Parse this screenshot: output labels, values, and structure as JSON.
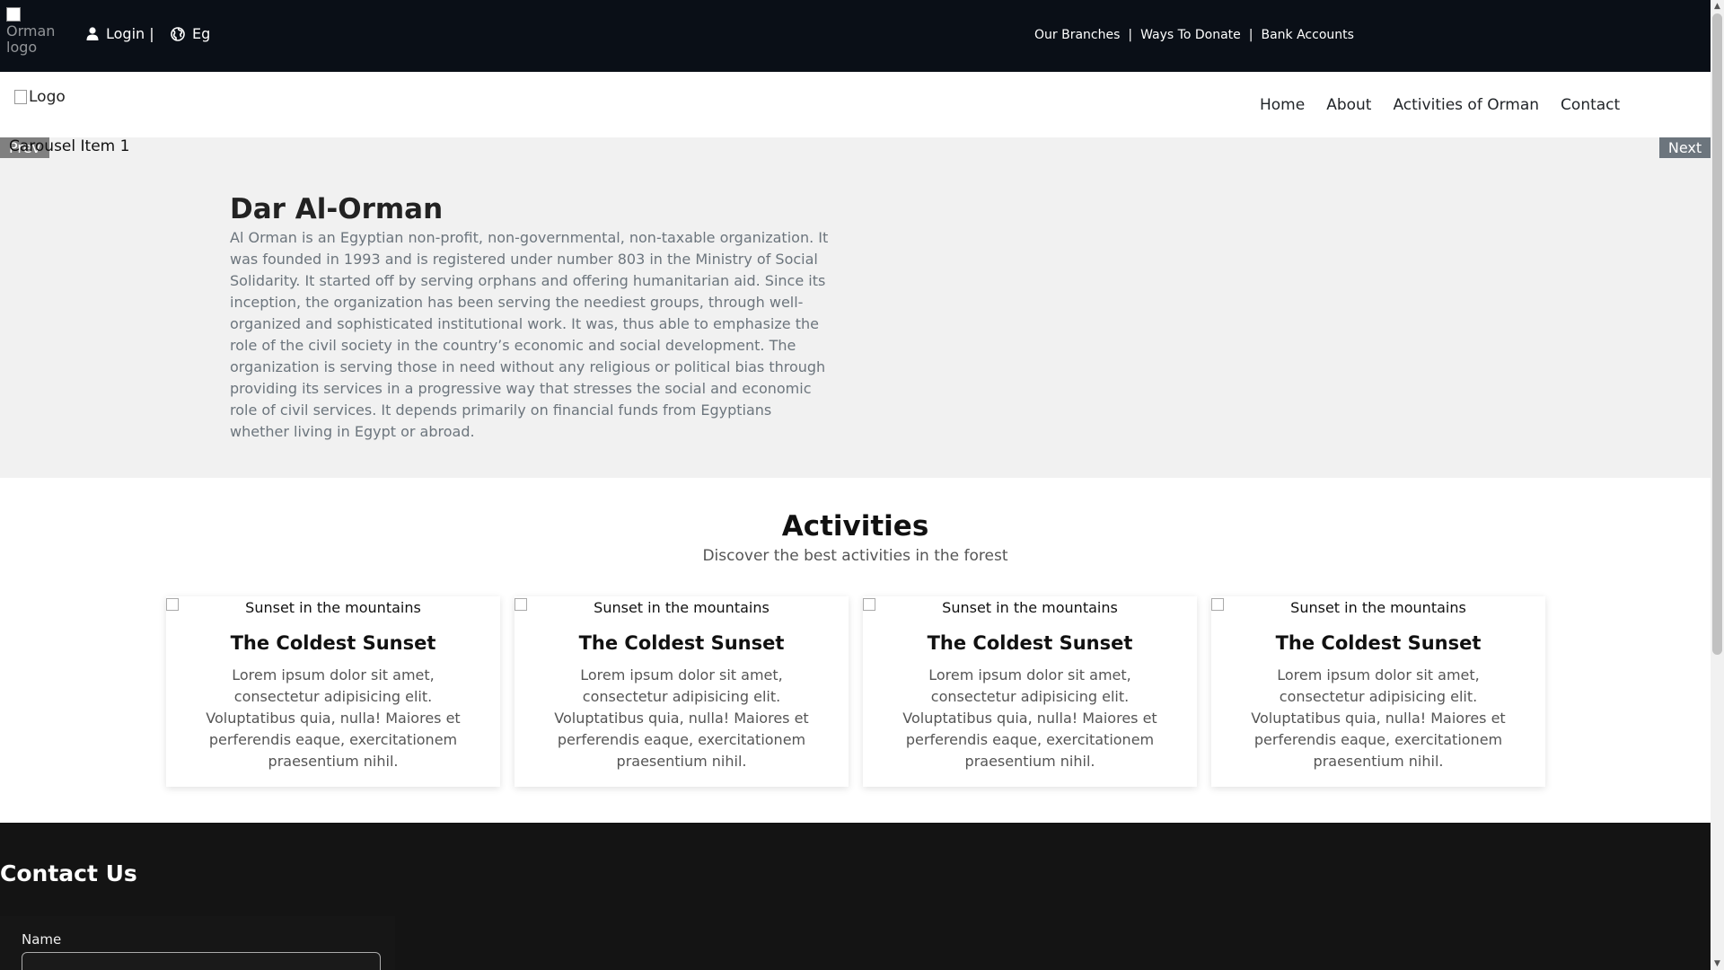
{
  "topbar": {
    "logo_alt": "Orman logo",
    "login_label": "Login |",
    "lang_label": "Eg",
    "links": [
      "Our Branches",
      "Ways To Donate",
      "Bank Accounts"
    ],
    "separator": "|"
  },
  "navbar": {
    "logo_alt": "Logo",
    "links": [
      "Home",
      "About",
      "Activities of Orman",
      "Contact"
    ]
  },
  "carousel": {
    "item_label": "Carousel Item 1",
    "prev_label": "Prev",
    "next_label": "Next",
    "title": "Dar Al-Orman",
    "text": "Al Orman is an Egyptian non-profit, non-governmental, non-taxable organization. It was founded in 1993 and is registered under number 803 in the Ministry of Social Solidarity. It started off by serving orphans and offering humanitarian aid. Since its inception, the organization has been serving the neediest groups, through well-organized and sophisticated institutional work. It was, thus able to emphasize the role of the civil society in the country’s economic and social development. The organization is serving those in need without any religious or political bias through providing its services in a progressive way that stresses the social and economic role of civil services. It depends primarily on financial funds from Egyptians whether living in Egypt or abroad."
  },
  "activities": {
    "title": "Activities",
    "subtitle": "Discover the best activities in the forest",
    "cards": [
      {
        "img_alt": "Sunset in the mountains",
        "title": "The Coldest Sunset",
        "text": "Lorem ipsum dolor sit amet, consectetur adipisicing elit. Voluptatibus quia, nulla! Maiores et perferendis eaque, exercitationem praesentium nihil."
      },
      {
        "img_alt": "Sunset in the mountains",
        "title": "The Coldest Sunset",
        "text": "Lorem ipsum dolor sit amet, consectetur adipisicing elit. Voluptatibus quia, nulla! Maiores et perferendis eaque, exercitationem praesentium nihil."
      },
      {
        "img_alt": "Sunset in the mountains",
        "title": "The Coldest Sunset",
        "text": "Lorem ipsum dolor sit amet, consectetur adipisicing elit. Voluptatibus quia, nulla! Maiores et perferendis eaque, exercitationem praesentium nihil."
      },
      {
        "img_alt": "Sunset in the mountains",
        "title": "The Coldest Sunset",
        "text": "Lorem ipsum dolor sit amet, consectetur adipisicing elit. Voluptatibus quia, nulla! Maiores et perferendis eaque, exercitationem praesentium nihil."
      }
    ]
  },
  "contact": {
    "title": "Contact Us",
    "name_label": "Name",
    "name_value": ""
  },
  "icons": {
    "user": "user-icon",
    "globe": "globe-icon"
  },
  "colors": {
    "topbar_bg": "#0a0f17",
    "carousel_bg": "#f1f1f1",
    "contact_bg": "#141414",
    "next_button_bg": "#6c757d"
  }
}
